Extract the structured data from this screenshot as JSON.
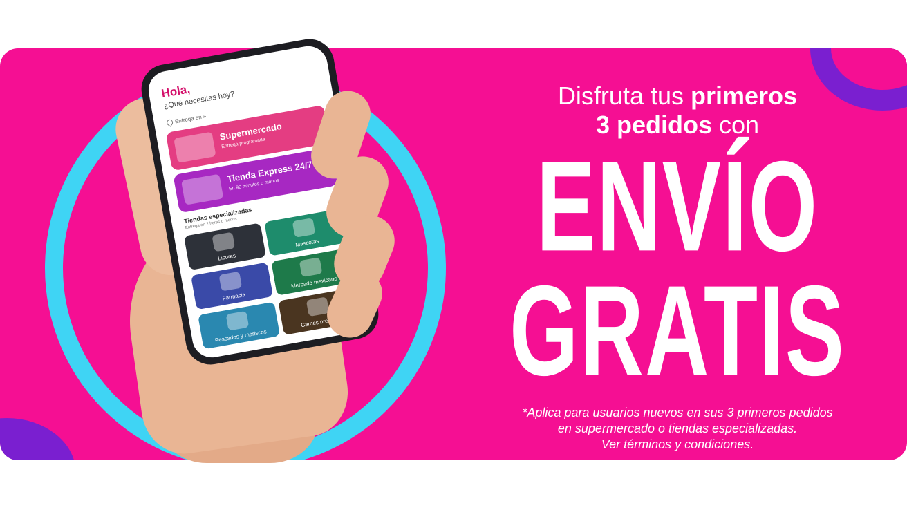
{
  "colors": {
    "banner_bg": "#f50f93",
    "ring": "#3fd4f4",
    "corner": "#7a1fd0",
    "text": "#ffffff"
  },
  "phone": {
    "greeting": "Hola,",
    "question": "¿Qué necesitas hoy?",
    "delivery_location": "Entrega en »",
    "cards": [
      {
        "title": "Supermercado",
        "subtitle": "Entrega programada"
      },
      {
        "title": "Tienda Express 24/7",
        "subtitle": "En 90 minutos o menos"
      }
    ],
    "specialty_title": "Tiendas especializadas",
    "specialty_subtitle": "Entrega en 2 horas o menos",
    "tiles": [
      "Licores",
      "Mascotas",
      "Farmacia",
      "Mercado mexicano",
      "Pescados y mariscos",
      "Carnes premium"
    ]
  },
  "promo": {
    "line1_regular": "Disfruta tus ",
    "line1_bold": "primeros",
    "line2_bold": "3 pedidos",
    "line2_regular": " con",
    "big1": "ENVÍO",
    "big2": "GRATIS",
    "fine1": "*Aplica para usuarios nuevos en sus 3 primeros pedidos",
    "fine2": "en supermercado o tiendas especializadas.",
    "fine3": "Ver términos y condiciones."
  }
}
